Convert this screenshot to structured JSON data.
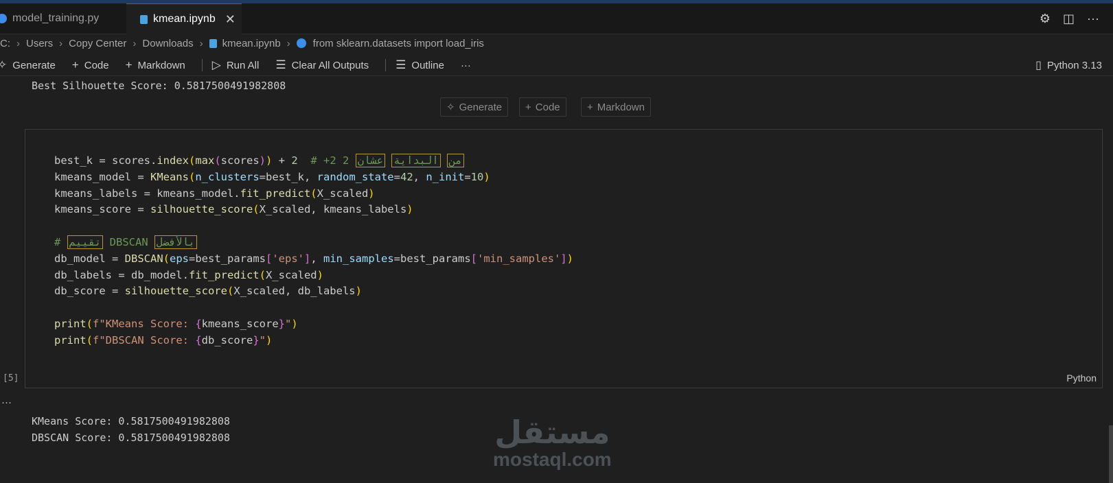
{
  "tabs": [
    {
      "label": "model_training.py",
      "icon": "python-icon"
    },
    {
      "label": "kmean.ipynb",
      "icon": "notebook-icon",
      "active": true
    }
  ],
  "tab_actions": {
    "settings": "⚙",
    "split": "◫",
    "more": "···"
  },
  "breadcrumbs": [
    "C:",
    "Users",
    "Copy Center",
    "Downloads",
    "kmean.ipynb",
    "from sklearn.datasets import load_iris"
  ],
  "toolbar": {
    "generate": "Generate",
    "code": "Code",
    "markdown": "Markdown",
    "run_all": "Run All",
    "clear_outputs": "Clear All Outputs",
    "outline": "Outline",
    "more": "···",
    "kernel": "Python 3.13"
  },
  "previous_output": "Best Silhouette Score: 0.5817500491982808",
  "insert_bar": {
    "generate": "Generate",
    "code": "Code",
    "markdown": "Markdown"
  },
  "cell": {
    "execution_count": "[5]",
    "language": "Python",
    "comment_ar_1": [
      "من",
      "البداية",
      "عشان"
    ],
    "comment_ar_2": [
      "تقييم",
      "بالأفضل"
    ]
  },
  "output": {
    "dots": "···",
    "lines": [
      "KMeans Score: 0.5817500491982808",
      "DBSCAN Score: 0.5817500491982808"
    ]
  },
  "watermark": {
    "arabic": "مستقل",
    "latin": "mostaql.com"
  },
  "colors": {
    "accent": "#0078d4",
    "background": "#1f1f1f",
    "tabbar": "#181818"
  }
}
